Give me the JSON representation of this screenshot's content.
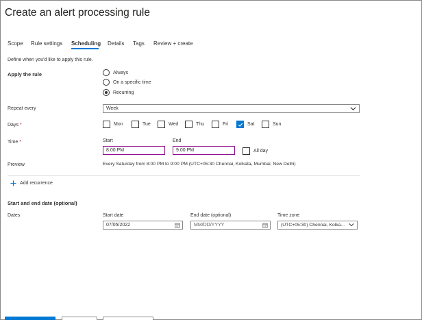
{
  "header": {
    "title": "Create an alert processing rule",
    "more_label": "···"
  },
  "tabs": [
    {
      "label": "Scope"
    },
    {
      "label": "Rule settings"
    },
    {
      "label": "Scheduling"
    },
    {
      "label": "Details"
    },
    {
      "label": "Tags"
    },
    {
      "label": "Review + create"
    }
  ],
  "description": "Define when you'd like to apply this rule.",
  "apply_rule": {
    "label": "Apply the rule",
    "options": [
      {
        "label": "Always"
      },
      {
        "label": "On a specific time"
      },
      {
        "label": "Recurring"
      }
    ],
    "selected": "Recurring"
  },
  "repeat_every": {
    "label": "Repeat every",
    "value": "Week"
  },
  "days": {
    "label": "Days",
    "required_mark": "*",
    "items": [
      {
        "label": "Mon",
        "checked": false
      },
      {
        "label": "Tue",
        "checked": false
      },
      {
        "label": "Wed",
        "checked": false
      },
      {
        "label": "Thu",
        "checked": false
      },
      {
        "label": "Fri",
        "checked": false
      },
      {
        "label": "Sat",
        "checked": true
      },
      {
        "label": "Sun",
        "checked": false
      }
    ]
  },
  "time": {
    "label": "Time",
    "required_mark": "*",
    "start_label": "Start",
    "start_value": "8:00 PM",
    "end_label": "End",
    "end_value": "9:00 PM",
    "all_day_label": "All day"
  },
  "preview": {
    "label": "Preview",
    "text": "Every Saturday from 8:00 PM to 9:00 PM (UTC+05:30 Chennai, Kolkata, Mumbai, New Delhi)"
  },
  "add_recurrence": {
    "label": "Add recurrence"
  },
  "dates_section": {
    "heading": "Start and end date (optional)",
    "label": "Dates",
    "start_date_label": "Start date",
    "start_date_value": "07/05/2022",
    "end_date_label": "End date (optional)",
    "end_date_placeholder": "MM/DD/YYYY",
    "time_zone_label": "Time zone",
    "time_zone_value": "(UTC+05:30) Chennai, Kolka..."
  },
  "colors": {
    "accent": "#0078d4",
    "focus_border": "#8e0f8e",
    "text": "#323130",
    "required": "#a4262c"
  }
}
